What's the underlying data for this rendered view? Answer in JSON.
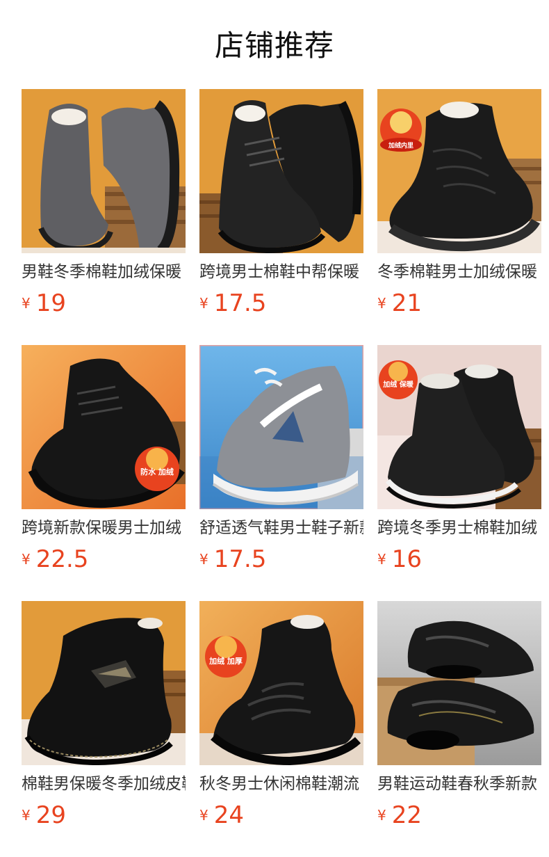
{
  "header": {
    "title": "店铺推荐"
  },
  "colors": {
    "price": "#e8431f",
    "title": "#111111",
    "name": "#333333"
  },
  "products": [
    {
      "name": "男鞋冬季棉鞋加绒保暖",
      "currency": "¥",
      "price": "19",
      "image": "grey-suede-fleece-boot",
      "bg": "#e29b3a"
    },
    {
      "name": "跨境男士棉鞋中帮保暖",
      "currency": "¥",
      "price": "17.5",
      "image": "black-leather-fleece-shoe",
      "bg": "#e29b3a"
    },
    {
      "name": "冬季棉鞋男士加绒保暖",
      "currency": "¥",
      "price": "21",
      "image": "black-quilted-boot",
      "bg": "#e8a445",
      "badge": "加绒内里"
    },
    {
      "name": "跨境新款保暖男士加绒",
      "currency": "¥",
      "price": "22.5",
      "image": "black-leather-sneaker",
      "bg": "#f0883a",
      "badge": "防水 加绒"
    },
    {
      "name": "舒适透气鞋男士鞋子新款",
      "currency": "¥",
      "price": "17.5",
      "image": "grey-blue-running-shoe",
      "bg": "#5aa6df"
    },
    {
      "name": "跨境冬季男士棉鞋加绒",
      "currency": "¥",
      "price": "16",
      "image": "black-slip-on-snow-boot",
      "bg": "#f4e6e2",
      "badge": "加绒 保暖"
    },
    {
      "name": "棉鞋男保暖冬季加绒皮鞋",
      "currency": "¥",
      "price": "29",
      "image": "black-leather-high-top",
      "bg": "#e29b3a"
    },
    {
      "name": "秋冬男士休闲棉鞋潮流",
      "currency": "¥",
      "price": "24",
      "image": "black-embossed-boot",
      "bg": "#e0913a",
      "badge": "加绒 加厚"
    },
    {
      "name": "男鞋运动鞋春秋季新款",
      "currency": "¥",
      "price": "22",
      "image": "black-air-cushion-sneakers",
      "bg": "#c7c7c7"
    }
  ]
}
